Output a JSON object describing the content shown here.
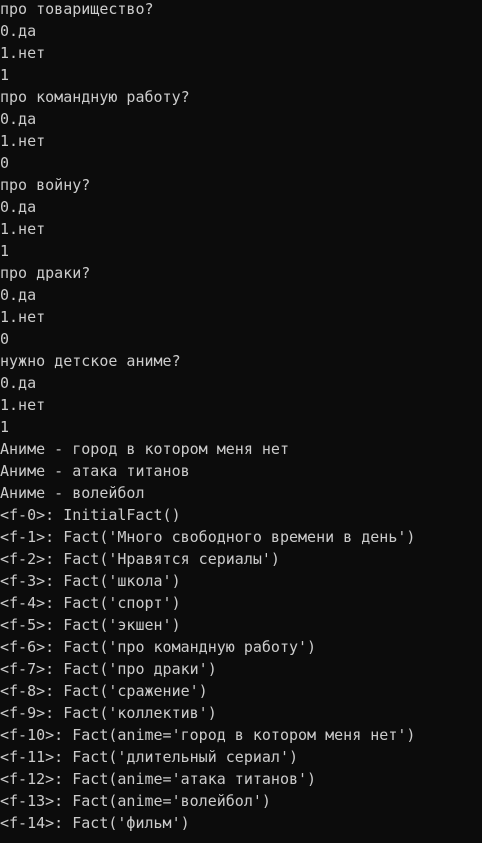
{
  "console": {
    "lines": [
      "про товарищество?",
      "0.да",
      "1.нет",
      "1",
      "про командную работу?",
      "0.да",
      "1.нет",
      "0",
      "про войну?",
      "0.да",
      "1.нет",
      "1",
      "про драки?",
      "0.да",
      "1.нет",
      "0",
      "нужно детское аниме?",
      "0.да",
      "1.нет",
      "1",
      "Аниме - город в котором меня нет",
      "Аниме - атака титанов",
      "Аниме - волейбол",
      "<f-0>: InitialFact()",
      "<f-1>: Fact('Много свободного времени в день')",
      "<f-2>: Fact('Нравятся сериалы')",
      "<f-3>: Fact('школа')",
      "<f-4>: Fact('спорт')",
      "<f-5>: Fact('экшен')",
      "<f-6>: Fact('про командную работу')",
      "<f-7>: Fact('про драки')",
      "<f-8>: Fact('сражение')",
      "<f-9>: Fact('коллектив')",
      "<f-10>: Fact(anime='город в котором меня нет')",
      "<f-11>: Fact('длительный сериал')",
      "<f-12>: Fact(anime='атака титанов')",
      "<f-13>: Fact(anime='волейбол')",
      "<f-14>: Fact('фильм')"
    ]
  }
}
